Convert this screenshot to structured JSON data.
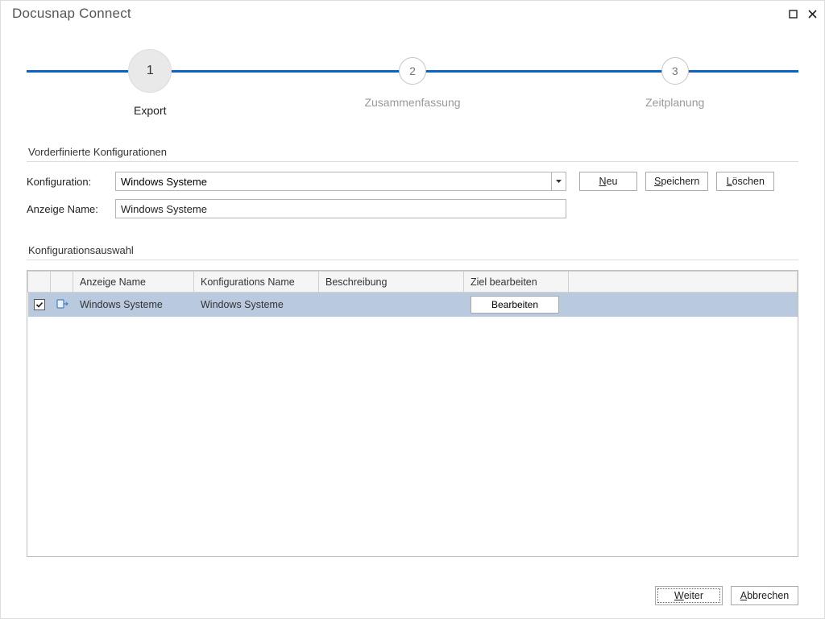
{
  "window": {
    "title_strong": "Docusnap",
    "title_light": "Connect"
  },
  "wizard": {
    "steps": [
      {
        "num": "1",
        "label": "Export",
        "active": true,
        "pos_pct": 16
      },
      {
        "num": "2",
        "label": "Zusammenfassung",
        "active": false,
        "pos_pct": 50
      },
      {
        "num": "3",
        "label": "Zeitplanung",
        "active": false,
        "pos_pct": 84
      }
    ]
  },
  "sections": {
    "predef_title": "Vorderfinierte Konfigurationen",
    "select_title": "Konfigurationsauswahl"
  },
  "form": {
    "config_label": "Konfiguration:",
    "config_value": "Windows Systeme",
    "displayname_label": "Anzeige Name:",
    "displayname_value": "Windows Systeme"
  },
  "buttons": {
    "new": {
      "pre": "",
      "ul": "N",
      "post": "eu"
    },
    "save": {
      "pre": "",
      "ul": "S",
      "post": "peichern"
    },
    "delete": {
      "pre": "",
      "ul": "L",
      "post": "öschen"
    },
    "next": {
      "pre": "",
      "ul": "W",
      "post": "eiter"
    },
    "cancel": {
      "pre": "",
      "ul": "A",
      "post": "bbrechen"
    },
    "edit_row": "Bearbeiten"
  },
  "grid": {
    "headers": {
      "display_name": "Anzeige Name",
      "config_name": "Konfigurations Name",
      "description": "Beschreibung",
      "edit_target": "Ziel bearbeiten"
    },
    "rows": [
      {
        "checked": true,
        "display_name": "Windows Systeme",
        "config_name": "Windows Systeme",
        "description": ""
      }
    ]
  }
}
